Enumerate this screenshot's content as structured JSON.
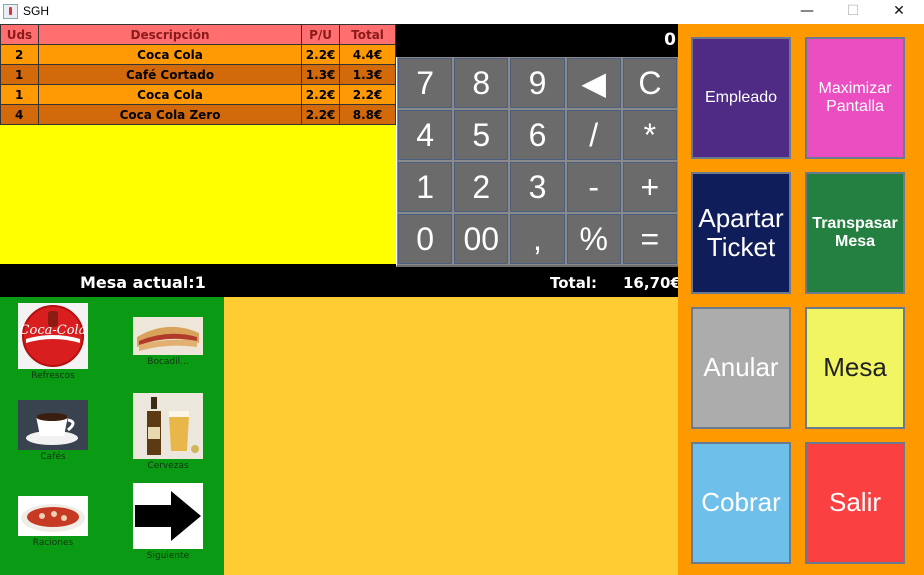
{
  "window": {
    "title": "SGH",
    "controls": [
      "—",
      "☐",
      "✕"
    ]
  },
  "order": {
    "headers": [
      "Uds",
      "Descripción",
      "P/U",
      "Total"
    ],
    "rows": [
      {
        "uds": "2",
        "desc": "Coca Cola",
        "pu": "2.2€",
        "total": "4.4€"
      },
      {
        "uds": "1",
        "desc": "Café Cortado",
        "pu": "1.3€",
        "total": "1.3€"
      },
      {
        "uds": "1",
        "desc": "Coca Cola",
        "pu": "2.2€",
        "total": "2.2€"
      },
      {
        "uds": "4",
        "desc": "Coca Cola Zero",
        "pu": "2.2€",
        "total": "8.8€"
      }
    ]
  },
  "display": {
    "value": "0"
  },
  "keypad": {
    "keys": [
      "7",
      "8",
      "9",
      "◀",
      "C",
      "4",
      "5",
      "6",
      "/",
      "*",
      "1",
      "2",
      "3",
      "-",
      "+",
      "0",
      "00",
      ",",
      "%",
      "="
    ]
  },
  "status": {
    "mesa": "Mesa actual:1",
    "total_label": "Total:",
    "total_value": "16,70€"
  },
  "categories": [
    {
      "label": "Refrescos",
      "icon": "coca-cola-logo"
    },
    {
      "label": "Bocadil...",
      "icon": "sandwich-photo"
    },
    {
      "label": "Cafés",
      "icon": "coffee-cup-photo"
    },
    {
      "label": "Cervezas",
      "icon": "beer-photo"
    },
    {
      "label": "Raciones",
      "icon": "tapas-plate-photo"
    },
    {
      "label": "Siguiente",
      "icon": "arrow-right-icon"
    }
  ],
  "actions": [
    {
      "label": "Empleado",
      "bg": "#4f2b85",
      "color": "#ffffff"
    },
    {
      "label": "Maximizar Pantalla",
      "bg": "#ea4ec0",
      "color": "#ffffff"
    },
    {
      "label": "Apartar Ticket",
      "bg": "#101d5b",
      "color": "#ffffff"
    },
    {
      "label": "Transpasar Mesa",
      "bg": "#248040",
      "color": "#ffffff"
    },
    {
      "label": "Anular",
      "bg": "#acacac",
      "color": "#ffffff"
    },
    {
      "label": "Mesa",
      "bg": "#f2f562",
      "color": "#222222"
    },
    {
      "label": "Cobrar",
      "bg": "#6ec0ea",
      "color": "#ffffff"
    },
    {
      "label": "Salir",
      "bg": "#fa4040",
      "color": "#ffffff"
    }
  ]
}
